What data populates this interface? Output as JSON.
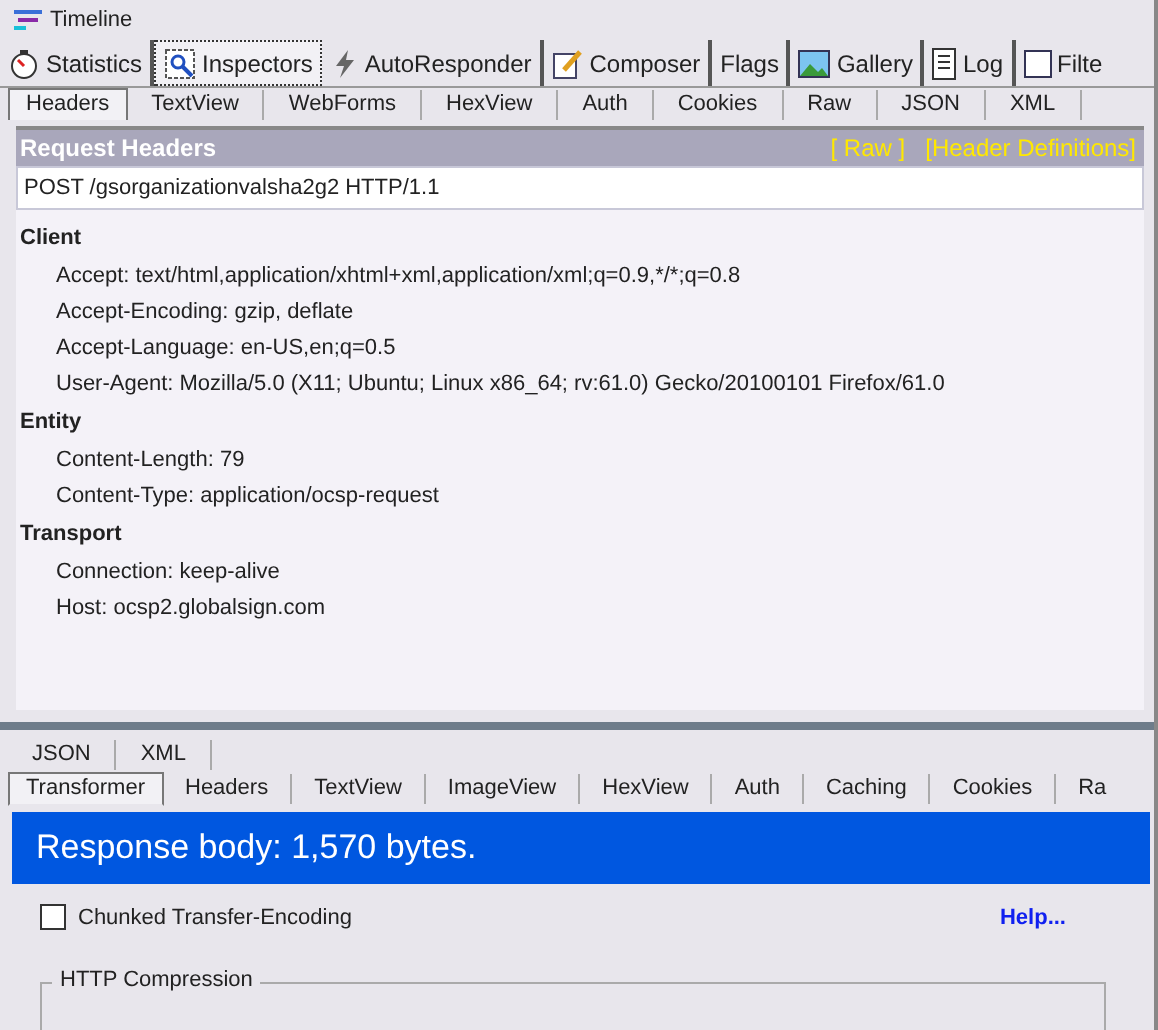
{
  "timeline": {
    "label": "Timeline"
  },
  "main_tabs": [
    {
      "label": "Statistics",
      "selected": false
    },
    {
      "label": "Inspectors",
      "selected": true
    },
    {
      "label": "AutoResponder",
      "selected": false
    },
    {
      "label": "Composer",
      "selected": false
    },
    {
      "label": "Flags",
      "selected": false
    },
    {
      "label": "Gallery",
      "selected": false
    },
    {
      "label": "Log",
      "selected": false
    },
    {
      "label": "Filte",
      "selected": false
    }
  ],
  "request_tabs": [
    {
      "label": "Headers",
      "selected": true
    },
    {
      "label": "TextView",
      "selected": false
    },
    {
      "label": "WebForms",
      "selected": false
    },
    {
      "label": "HexView",
      "selected": false
    },
    {
      "label": "Auth",
      "selected": false
    },
    {
      "label": "Cookies",
      "selected": false
    },
    {
      "label": "Raw",
      "selected": false
    },
    {
      "label": "JSON",
      "selected": false
    },
    {
      "label": "XML",
      "selected": false
    }
  ],
  "request_headers": {
    "title": "Request Headers",
    "links": [
      "[ Raw ]",
      "[Header Definitions]"
    ],
    "request_line": "POST /gsorganizationvalsha2g2 HTTP/1.1",
    "groups": [
      {
        "name": "Client",
        "headers": [
          "Accept: text/html,application/xhtml+xml,application/xml;q=0.9,*/*;q=0.8",
          "Accept-Encoding: gzip, deflate",
          "Accept-Language: en-US,en;q=0.5",
          "User-Agent: Mozilla/5.0 (X11; Ubuntu; Linux x86_64; rv:61.0) Gecko/20100101 Firefox/61.0"
        ]
      },
      {
        "name": "Entity",
        "headers": [
          "Content-Length: 79",
          "Content-Type: application/ocsp-request"
        ]
      },
      {
        "name": "Transport",
        "headers": [
          "Connection: keep-alive",
          "Host: ocsp2.globalsign.com"
        ]
      }
    ]
  },
  "response_tabs_row1": [
    {
      "label": "JSON",
      "selected": false
    },
    {
      "label": "XML",
      "selected": false
    }
  ],
  "response_tabs_row2": [
    {
      "label": "Transformer",
      "selected": true
    },
    {
      "label": "Headers",
      "selected": false
    },
    {
      "label": "TextView",
      "selected": false
    },
    {
      "label": "ImageView",
      "selected": false
    },
    {
      "label": "HexView",
      "selected": false
    },
    {
      "label": "Auth",
      "selected": false
    },
    {
      "label": "Caching",
      "selected": false
    },
    {
      "label": "Cookies",
      "selected": false
    },
    {
      "label": "Ra",
      "selected": false
    }
  ],
  "transformer": {
    "banner": "Response body: 1,570 bytes.",
    "chunked": {
      "label": "Chunked Transfer-Encoding",
      "checked": false
    },
    "help": "Help...",
    "compression_group": "HTTP Compression"
  }
}
